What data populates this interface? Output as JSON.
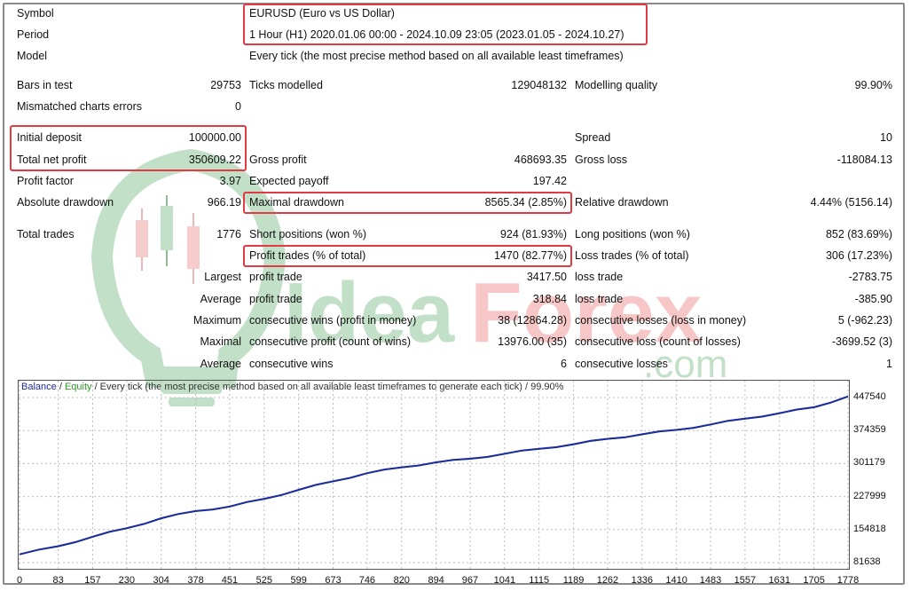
{
  "report": {
    "symbol_label": "Symbol",
    "symbol_value": "EURUSD (Euro vs US Dollar)",
    "period_label": "Period",
    "period_value": "1 Hour (H1) 2020.01.06 00:00 - 2024.10.09 23:05 (2023.01.05 - 2024.10.27)",
    "model_label": "Model",
    "model_value": "Every tick (the most precise method based on all available least timeframes)",
    "bars_label": "Bars in test",
    "bars_value": "29753",
    "ticks_label": "Ticks modelled",
    "ticks_value": "129048132",
    "quality_label": "Modelling quality",
    "quality_value": "99.90%",
    "mismatch_label": "Mismatched charts errors",
    "mismatch_value": "0",
    "deposit_label": "Initial deposit",
    "deposit_value": "100000.00",
    "spread_label": "Spread",
    "spread_value": "10",
    "netprofit_label": "Total net profit",
    "netprofit_value": "350609.22",
    "grossprofit_label": "Gross profit",
    "grossprofit_value": "468693.35",
    "grossloss_label": "Gross loss",
    "grossloss_value": "-118084.13",
    "pf_label": "Profit factor",
    "pf_value": "3.97",
    "payoff_label": "Expected payoff",
    "payoff_value": "197.42",
    "absdd_label": "Absolute drawdown",
    "absdd_value": "966.19",
    "maxdd_label": "Maximal drawdown",
    "maxdd_value": "8565.34 (2.85%)",
    "reldd_label": "Relative drawdown",
    "reldd_value": "4.44% (5156.14)",
    "trades_label": "Total trades",
    "trades_value": "1776",
    "short_label": "Short positions (won %)",
    "short_value": "924 (81.93%)",
    "long_label": "Long positions (won %)",
    "long_value": "852 (83.69%)",
    "ptrades_label": "Profit trades (% of total)",
    "ptrades_value": "1470 (82.77%)",
    "ltrades_label": "Loss trades (% of total)",
    "ltrades_value": "306 (17.23%)",
    "largest_label": "Largest",
    "largest_profit_label": "profit trade",
    "largest_profit_value": "3417.50",
    "largest_loss_label": "loss trade",
    "largest_loss_value": "-2783.75",
    "average_label": "Average",
    "average_profit_label": "profit trade",
    "average_profit_value": "318.84",
    "average_loss_label": "loss trade",
    "average_loss_value": "-385.90",
    "max_label": "Maximum",
    "max_wins_label": "consecutive wins (profit in money)",
    "max_wins_value": "38 (12864.28)",
    "max_losses_label": "consecutive losses (loss in money)",
    "max_losses_value": "5 (-962.23)",
    "maximal_label": "Maximal",
    "maximal_profit_label": "consecutive profit (count of wins)",
    "maximal_profit_value": "13976.00 (35)",
    "maximal_loss_label": "consecutive loss (count of losses)",
    "maximal_loss_value": "-3699.52 (3)",
    "avgc_label": "Average",
    "avgc_wins_label": "consecutive wins",
    "avgc_wins_value": "6",
    "avgc_losses_label": "consecutive losses",
    "avgc_losses_value": "1"
  },
  "watermark": {
    "brand": "IdeaForex",
    "domain": ".com",
    "colors": {
      "green": "#8fc79a",
      "red": "#f2a3a3"
    }
  },
  "legend": {
    "balance": "Balance",
    "sep1": " / ",
    "equity": "Equity",
    "rest": " / Every tick (the most precise method based on all available least timeframes to generate each tick) / 99.90%"
  },
  "colors": {
    "highlight": "#e03a45",
    "balance": "#1d2aa0",
    "equity": "#2a9a2a"
  },
  "chart_data": {
    "type": "line",
    "title": "",
    "xlabel": "",
    "ylabel": "",
    "x_ticks": [
      "0",
      "83",
      "157",
      "230",
      "304",
      "378",
      "451",
      "525",
      "599",
      "673",
      "746",
      "820",
      "894",
      "967",
      "1041",
      "1115",
      "1189",
      "1262",
      "1336",
      "1410",
      "1483",
      "1557",
      "1631",
      "1705",
      "1778"
    ],
    "y_ticks": [
      "447540",
      "374359",
      "301179",
      "227999",
      "154818",
      "81638"
    ],
    "xlim": [
      0,
      1778
    ],
    "ylim": [
      81638,
      447540
    ],
    "series": [
      {
        "name": "Balance",
        "x": [
          0,
          83,
          157,
          230,
          304,
          378,
          451,
          525,
          599,
          673,
          746,
          820,
          894,
          967,
          1041,
          1115,
          1189,
          1262,
          1336,
          1410,
          1483,
          1557,
          1631,
          1705,
          1778
        ],
        "y": [
          100000,
          118000,
          139000,
          158000,
          180000,
          196000,
          206000,
          223000,
          243000,
          262000,
          280000,
          293000,
          304000,
          312000,
          323000,
          334000,
          344000,
          356000,
          366000,
          376000,
          388000,
          401000,
          413000,
          426000,
          450000
        ]
      },
      {
        "name": "Equity",
        "x": [
          0,
          83,
          157,
          230,
          304,
          378,
          451,
          525,
          599,
          673,
          746,
          820,
          894,
          967,
          1041,
          1115,
          1189,
          1262,
          1336,
          1410,
          1483,
          1557,
          1631,
          1705,
          1778
        ],
        "y": [
          99500,
          117300,
          138200,
          157400,
          179200,
          195500,
          205400,
          222300,
          242500,
          261400,
          279600,
          292400,
          303500,
          311300,
          322400,
          333500,
          343300,
          355400,
          365300,
          375500,
          387300,
          400400,
          412300,
          425400,
          449300
        ]
      }
    ]
  }
}
